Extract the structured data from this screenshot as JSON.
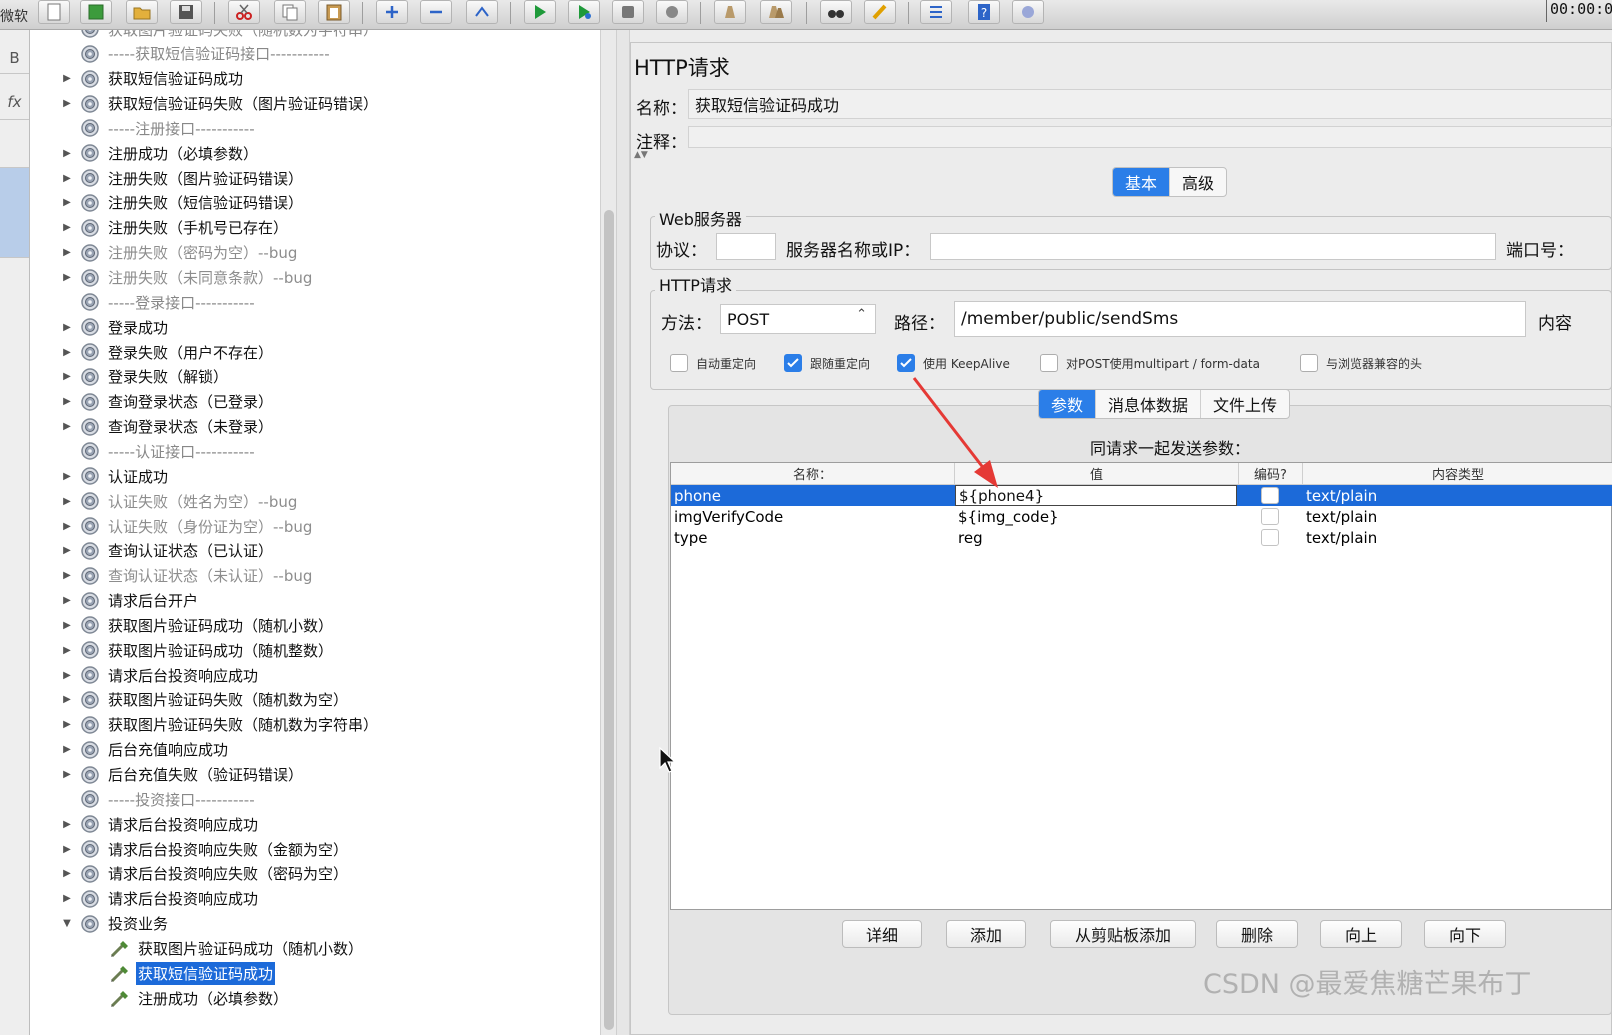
{
  "toolbar": {
    "app_abbr": "微软",
    "timer": "00:00:0",
    "buttons": [
      {
        "name": "new-icon"
      },
      {
        "name": "templates-icon"
      },
      {
        "name": "open-icon"
      },
      {
        "name": "save-icon"
      },
      {
        "name": "cut-icon"
      },
      {
        "name": "copy-icon"
      },
      {
        "name": "paste-icon"
      },
      {
        "name": "expand-icon"
      },
      {
        "name": "collapse-icon"
      },
      {
        "name": "toggle-icon"
      },
      {
        "name": "start-icon"
      },
      {
        "name": "start-no-pause-icon"
      },
      {
        "name": "stop-icon"
      },
      {
        "name": "shutdown-icon"
      },
      {
        "name": "clear-icon"
      },
      {
        "name": "clear-all-icon"
      },
      {
        "name": "search-icon"
      },
      {
        "name": "reset-search-icon"
      },
      {
        "name": "function-helper-icon"
      },
      {
        "name": "help-icon"
      },
      {
        "name": "remote-icon"
      }
    ]
  },
  "side_strip": {
    "cell_b": "B",
    "cell_fx": "fx"
  },
  "tree": {
    "items": [
      {
        "label": "获取图片验证码失败（随机数为字符串）",
        "type": "sep"
      },
      {
        "label": "-----获取短信验证码接口-----------",
        "type": "sep"
      },
      {
        "label": "获取短信验证码成功",
        "type": "node"
      },
      {
        "label": "获取短信验证码失败（图片验证码错误）",
        "type": "node"
      },
      {
        "label": "-----注册接口-----------",
        "type": "sep"
      },
      {
        "label": "注册成功（必填参数）",
        "type": "node"
      },
      {
        "label": "注册失败（图片验证码错误）",
        "type": "node"
      },
      {
        "label": "注册失败（短信验证码错误）",
        "type": "node"
      },
      {
        "label": "注册失败（手机号已存在）",
        "type": "node"
      },
      {
        "label": "注册失败（密码为空）--bug",
        "type": "disabled"
      },
      {
        "label": "注册失败（未同意条款）--bug",
        "type": "disabled"
      },
      {
        "label": "-----登录接口-----------",
        "type": "sep"
      },
      {
        "label": "登录成功",
        "type": "node"
      },
      {
        "label": "登录失败（用户不存在）",
        "type": "node"
      },
      {
        "label": "登录失败（解锁）",
        "type": "node"
      },
      {
        "label": "查询登录状态（已登录）",
        "type": "node"
      },
      {
        "label": "查询登录状态（未登录）",
        "type": "node"
      },
      {
        "label": "-----认证接口-----------",
        "type": "sep"
      },
      {
        "label": "认证成功",
        "type": "node"
      },
      {
        "label": "认证失败（姓名为空）--bug",
        "type": "disabled"
      },
      {
        "label": "认证失败（身份证为空）--bug",
        "type": "disabled"
      },
      {
        "label": "查询认证状态（已认证）",
        "type": "node"
      },
      {
        "label": "查询认证状态（未认证）--bug",
        "type": "disabled"
      },
      {
        "label": "请求后台开户",
        "type": "node"
      },
      {
        "label": "获取图片验证码成功（随机小数）",
        "type": "node"
      },
      {
        "label": "获取图片验证码成功（随机整数）",
        "type": "node"
      },
      {
        "label": "请求后台投资响应成功",
        "type": "node"
      },
      {
        "label": "获取图片验证码失败（随机数为空）",
        "type": "node"
      },
      {
        "label": "获取图片验证码失败（随机数为字符串）",
        "type": "node"
      },
      {
        "label": "后台充值响应成功",
        "type": "node"
      },
      {
        "label": "后台充值失败（验证码错误）",
        "type": "node"
      },
      {
        "label": "-----投资接口-----------",
        "type": "sep"
      },
      {
        "label": "请求后台投资响应成功",
        "type": "node"
      },
      {
        "label": "请求后台投资响应失败（金额为空）",
        "type": "node"
      },
      {
        "label": "请求后台投资响应失败（密码为空）",
        "type": "node"
      },
      {
        "label": "请求后台投资响应成功",
        "type": "node"
      },
      {
        "label": "投资业务",
        "type": "open"
      },
      {
        "label": "获取图片验证码成功（随机小数）",
        "type": "child"
      },
      {
        "label": "获取短信验证码成功",
        "type": "child-selected"
      },
      {
        "label": "注册成功（必填参数）",
        "type": "child"
      }
    ]
  },
  "sampler": {
    "title": "HTTP请求",
    "name_label": "名称：",
    "name_value": "获取短信验证码成功",
    "comment_label": "注释：",
    "comment_value": "",
    "tabs": [
      {
        "label": "基本",
        "active": true
      },
      {
        "label": "高级",
        "active": false
      }
    ],
    "web_server": {
      "group_title": "Web服务器",
      "protocol_label": "协议：",
      "protocol_value": "",
      "server_label": "服务器名称或IP：",
      "server_value": "",
      "port_label": "端口号："
    },
    "http_request": {
      "group_title": "HTTP请求",
      "method_label": "方法：",
      "method_value": "POST",
      "path_label": "路径：",
      "path_value": "/member/public/sendSms",
      "content_encoding_label": "内容"
    },
    "checkboxes": [
      {
        "label": "自动重定向",
        "checked": false
      },
      {
        "label": "跟随重定向",
        "checked": true
      },
      {
        "label": "使用 KeepAlive",
        "checked": true
      },
      {
        "label": "对POST使用multipart / form-data",
        "checked": false
      },
      {
        "label": "与浏览器兼容的头",
        "checked": false
      }
    ],
    "body_tabs": [
      {
        "label": "参数",
        "active": true
      },
      {
        "label": "消息体数据",
        "active": false
      },
      {
        "label": "文件上传",
        "active": false
      }
    ],
    "params_caption": "同请求一起发送参数：",
    "params_columns": [
      "名称：",
      "值",
      "编码?",
      "内容类型"
    ],
    "params_rows": [
      {
        "name": "phone",
        "value": "${phone4}",
        "encode": false,
        "content_type": "text/plain",
        "selected": true
      },
      {
        "name": "imgVerifyCode",
        "value": "${img_code}",
        "encode": false,
        "content_type": "text/plain",
        "selected": false
      },
      {
        "name": "type",
        "value": "reg",
        "encode": false,
        "content_type": "text/plain",
        "selected": false
      }
    ],
    "buttons": {
      "detail": "详细",
      "add": "添加",
      "add_clipboard": "从剪贴板添加",
      "delete": "删除",
      "up": "向上",
      "down": "向下"
    }
  },
  "watermark": "CSDN @最爱焦糖芒果布丁",
  "colors": {
    "selection": "#1c6ad9",
    "accent": "#2b7ee8",
    "annotation_arrow": "#e53935"
  }
}
